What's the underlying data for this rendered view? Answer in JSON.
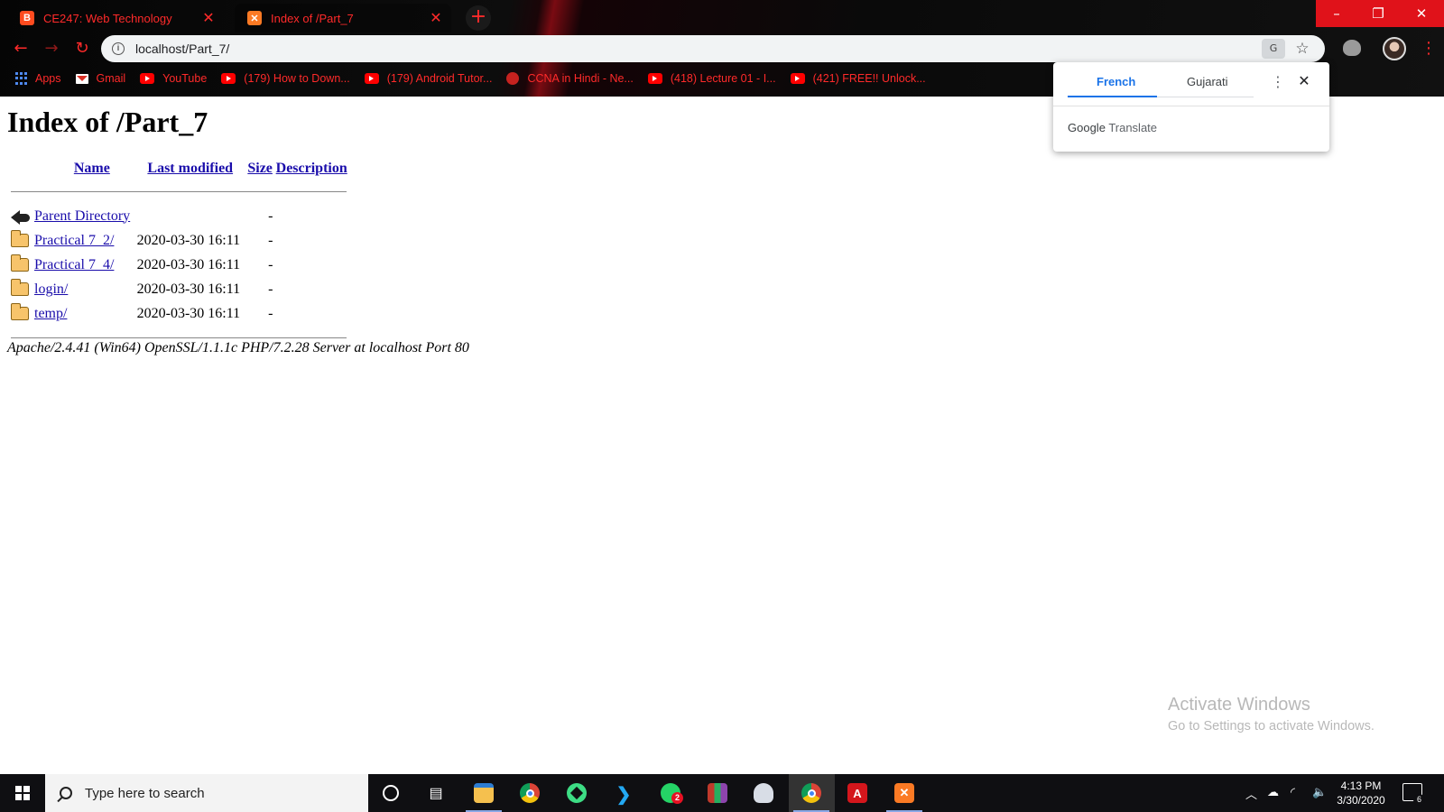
{
  "browser": {
    "tabs": [
      {
        "title": "CE247: Web Technology",
        "favicon": "blogger-icon",
        "active": false
      },
      {
        "title": "Index of /Part_7",
        "favicon": "xampp-icon",
        "active": true
      }
    ],
    "new_tab_glyph": "+",
    "window_controls": {
      "minimize": "–",
      "restore": "❐",
      "close": "✕"
    },
    "address": "localhost/Part_7/",
    "accent_color": "#ff2a2a",
    "bookmarks": [
      {
        "label": "Apps",
        "icon": "apps-grid-icon"
      },
      {
        "label": "Gmail",
        "icon": "gmail-icon"
      },
      {
        "label": "YouTube",
        "icon": "youtube-icon"
      },
      {
        "label": "(179) How to Down...",
        "icon": "youtube-icon"
      },
      {
        "label": "(179) Android Tutor...",
        "icon": "youtube-icon"
      },
      {
        "label": "CCNA in Hindi - Ne...",
        "icon": "globe-icon"
      },
      {
        "label": "(418) Lecture 01 - I...",
        "icon": "youtube-icon"
      },
      {
        "label": "(421) FREE!! Unlock...",
        "icon": "youtube-icon"
      }
    ]
  },
  "translate_popup": {
    "selected_language": "French",
    "other_language": "Gujarati",
    "brand_google": "Google",
    "brand_translate": "Translate",
    "accent_color": "#1a73e8"
  },
  "page": {
    "heading": "Index of /Part_7",
    "columns": {
      "name": "Name",
      "last_modified": "Last modified",
      "size": "Size",
      "description": "Description"
    },
    "rows": [
      {
        "name": "Parent Directory",
        "modified": "",
        "size": "-",
        "icon": "back-icon"
      },
      {
        "name": "Practical 7_2/",
        "modified": "2020-03-30 16:11",
        "size": "-",
        "icon": "folder-icon"
      },
      {
        "name": "Practical 7_4/",
        "modified": "2020-03-30 16:11",
        "size": "-",
        "icon": "folder-icon"
      },
      {
        "name": "login/",
        "modified": "2020-03-30 16:11",
        "size": "-",
        "icon": "folder-icon"
      },
      {
        "name": "temp/",
        "modified": "2020-03-30 16:11",
        "size": "-",
        "icon": "folder-icon"
      }
    ],
    "footer": "Apache/2.4.41 (Win64) OpenSSL/1.1.1c PHP/7.2.28 Server at localhost Port 80"
  },
  "watermark": {
    "line1": "Activate Windows",
    "line2": "Go to Settings to activate Windows."
  },
  "taskbar": {
    "search_placeholder": "Type here to search",
    "pinned": [
      "cortana-icon",
      "task-view-icon",
      "file-explorer-icon",
      "chrome-icon",
      "android-studio-icon",
      "vscode-icon",
      "whatsapp-icon",
      "winrar-icon",
      "snipping-tool-icon",
      "chrome-icon",
      "acrobat-icon",
      "xampp-icon"
    ],
    "whatsapp_badge": "2",
    "time": "4:13 PM",
    "date": "3/30/2020",
    "notification_count": "6"
  }
}
